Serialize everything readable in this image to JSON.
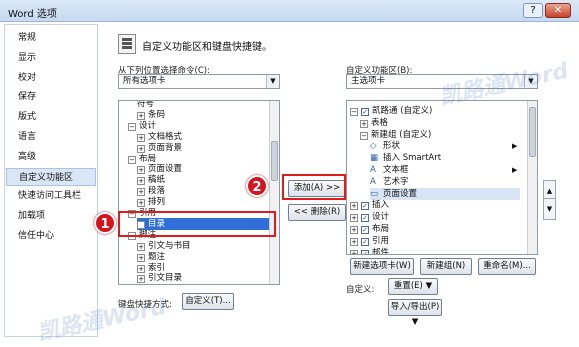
{
  "window": {
    "title": "Word 选项",
    "help_label": "?",
    "close_label": "✕"
  },
  "nav": {
    "items": [
      "常规",
      "显示",
      "校对",
      "保存",
      "版式",
      "语言",
      "高级",
      "自定义功能区",
      "快速访问工具栏",
      "加载项",
      "信任中心"
    ],
    "selected_index": 7
  },
  "header": {
    "title": "自定义功能区和键盘快捷键。"
  },
  "left": {
    "choose_label": "从下列位置选择命令(C):",
    "choose_value": "所有选项卡",
    "tree": [
      {
        "indent": 2,
        "exp": "",
        "text": "符号"
      },
      {
        "indent": 2,
        "exp": "⊞",
        "text": "条码"
      },
      {
        "indent": 1,
        "exp": "⊟",
        "text": "设计"
      },
      {
        "indent": 2,
        "exp": "⊞",
        "text": "文档格式"
      },
      {
        "indent": 2,
        "exp": "⊞",
        "text": "页面背景"
      },
      {
        "indent": 1,
        "exp": "⊟",
        "text": "布局"
      },
      {
        "indent": 2,
        "exp": "⊞",
        "text": "页面设置"
      },
      {
        "indent": 2,
        "exp": "⊞",
        "text": "稿纸"
      },
      {
        "indent": 2,
        "exp": "⊞",
        "text": "段落"
      },
      {
        "indent": 2,
        "exp": "⊞",
        "text": "排列"
      },
      {
        "indent": 1,
        "exp": "⊟",
        "text": "引用"
      },
      {
        "indent": 2,
        "exp": "⊞",
        "text": "目录"
      },
      {
        "indent": 1,
        "exp": "⊟",
        "text": "脚注"
      },
      {
        "indent": 2,
        "exp": "⊞",
        "text": "引文与书目"
      },
      {
        "indent": 2,
        "exp": "⊞",
        "text": "题注"
      },
      {
        "indent": 2,
        "exp": "⊞",
        "text": "索引"
      },
      {
        "indent": 2,
        "exp": "⊞",
        "text": "引文目录"
      }
    ],
    "selected_index": 11,
    "kb_label": "键盘快捷方式:",
    "kb_button": "自定义(T)..."
  },
  "middle": {
    "add_label": "添加(A) >>",
    "remove_label": "<< 删除(R)"
  },
  "right": {
    "custom_label": "自定义功能区(B):",
    "custom_value": "主选项卡",
    "tree": [
      {
        "indent": 0,
        "exp": "⊟",
        "chk": "✓",
        "text": "凯路通 (自定义)"
      },
      {
        "indent": 1,
        "exp": "⊞",
        "chk": "",
        "text": "表格"
      },
      {
        "indent": 1,
        "exp": "⊟",
        "chk": "",
        "text": "新建组 (自定义)"
      },
      {
        "indent": 2,
        "exp": "",
        "chk": "",
        "text": "形状",
        "icon": "◇",
        "more": true
      },
      {
        "indent": 2,
        "exp": "",
        "chk": "",
        "text": "插入 SmartArt",
        "icon": "▦"
      },
      {
        "indent": 2,
        "exp": "",
        "chk": "",
        "text": "文本框",
        "icon": "A",
        "more": true
      },
      {
        "indent": 2,
        "exp": "",
        "chk": "",
        "text": "艺术字",
        "icon": "A"
      },
      {
        "indent": 2,
        "exp": "",
        "chk": "",
        "text": "页面设置",
        "icon": "▭"
      },
      {
        "indent": 0,
        "exp": "⊞",
        "chk": "✓",
        "text": "插入"
      },
      {
        "indent": 0,
        "exp": "⊞",
        "chk": "✓",
        "text": "设计"
      },
      {
        "indent": 0,
        "exp": "⊞",
        "chk": "✓",
        "text": "布局"
      },
      {
        "indent": 0,
        "exp": "⊞",
        "chk": "✓",
        "text": "引用"
      },
      {
        "indent": 0,
        "exp": "⊞",
        "chk": "✓",
        "text": "邮件"
      }
    ],
    "highlight_index": 7,
    "new_tab": "新建选项卡(W)",
    "new_group": "新建组(N)",
    "rename": "重命名(M)...",
    "custom_def_label": "自定义:",
    "reset_value": "重置(E)",
    "import_value": "导入/导出(P)"
  },
  "annotations": {
    "badge1": "1",
    "badge2": "2"
  },
  "watermarks": [
    "凯路通Word",
    "凯路通Word"
  ]
}
